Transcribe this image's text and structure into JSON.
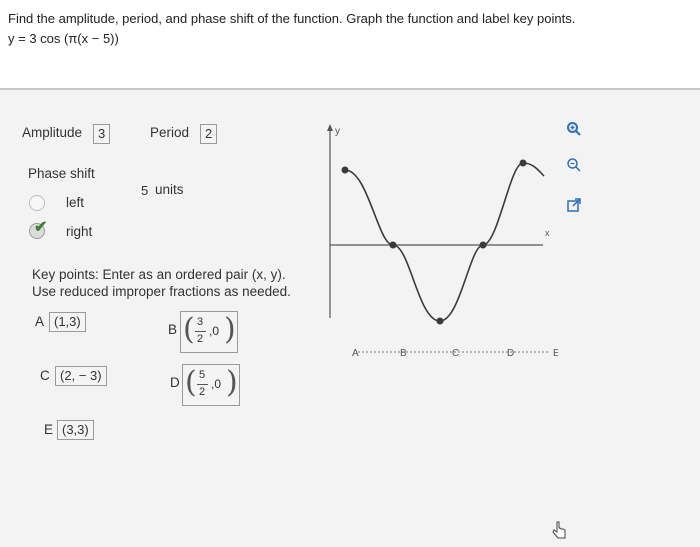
{
  "question": {
    "line1": "Find the amplitude, period, and phase shift of the function. Graph the function and label key points.",
    "line2": "y = 3 cos (π(x − 5))"
  },
  "amplitude": {
    "label": "Amplitude",
    "value": "3"
  },
  "period": {
    "label": "Period",
    "value": "2"
  },
  "phase_shift": {
    "label": "Phase shift",
    "value": "5",
    "units_label": "units",
    "options": [
      {
        "label": "left",
        "selected": false
      },
      {
        "label": "right",
        "selected": true
      }
    ]
  },
  "key_points": {
    "instruction_line1": "Key points:  Enter as an ordered pair (x, y).",
    "instruction_line2": "Use reduced improper fractions as needed.",
    "A": {
      "label": "A",
      "value": "(1,3)"
    },
    "B": {
      "label": "B",
      "num": "3",
      "den": "2",
      "rest": ",0"
    },
    "C": {
      "label": "C",
      "value": "(2, − 3)"
    },
    "D": {
      "label": "D",
      "num": "5",
      "den": "2",
      "rest": ",0"
    },
    "E": {
      "label": "E",
      "value": "(3,3)"
    }
  },
  "graph": {
    "y_axis_label": "y",
    "x_axis_label": "x",
    "point_labels": [
      "A",
      "B",
      "C",
      "D",
      "E"
    ],
    "curve_color": "#3a3a3a",
    "axis_color": "#555555"
  },
  "tools": [
    "zoom-in-icon",
    "zoom-out-icon",
    "external-link-icon"
  ],
  "colors": {
    "accent": "#2f6fb3",
    "check": "#3f7f2f"
  }
}
